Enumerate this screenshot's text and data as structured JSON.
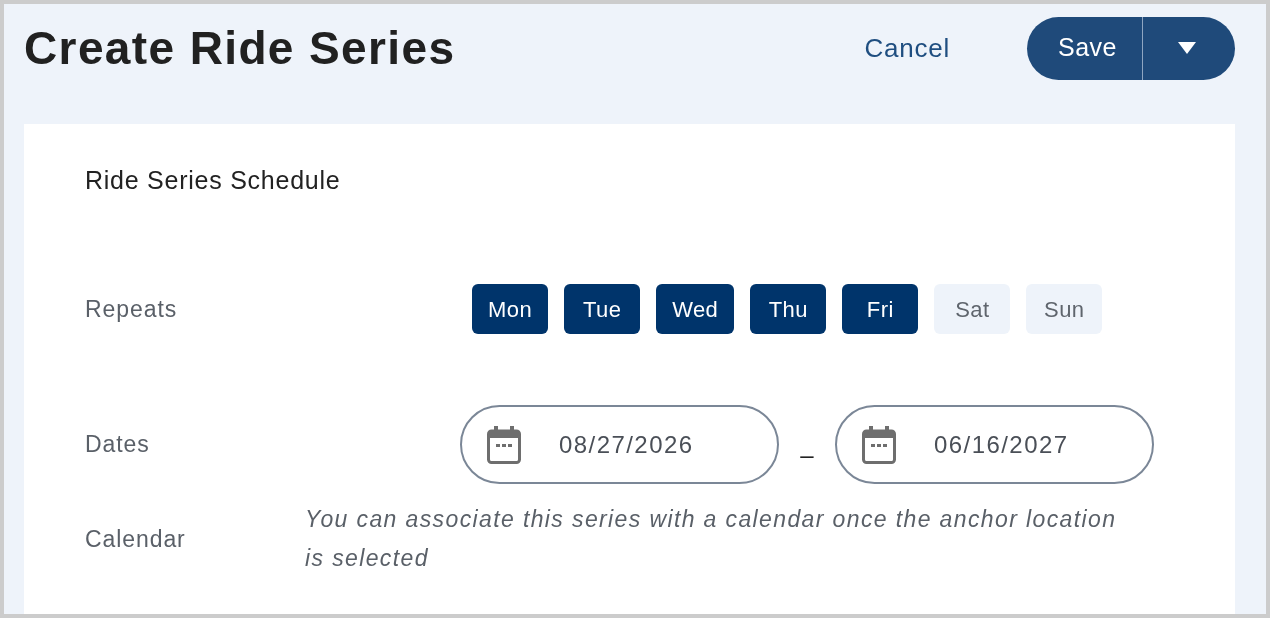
{
  "header": {
    "title": "Create Ride Series",
    "cancel": "Cancel",
    "save": "Save"
  },
  "schedule": {
    "title": "Ride Series Schedule",
    "rows": [
      {
        "kind": "days",
        "label": "Repeats",
        "days": [
          {
            "label": "Mon",
            "selected": true
          },
          {
            "label": "Tue",
            "selected": true
          },
          {
            "label": "Wed",
            "selected": true
          },
          {
            "label": "Thu",
            "selected": true
          },
          {
            "label": "Fri",
            "selected": true
          },
          {
            "label": "Sat",
            "selected": false
          },
          {
            "label": "Sun",
            "selected": false
          }
        ]
      },
      {
        "kind": "dates",
        "label": "Dates",
        "start": "08/27/2026",
        "separator": "–",
        "end": "06/16/2027"
      },
      {
        "kind": "note",
        "label": "Calendar",
        "note": "You can associate this series with a calendar once the anchor location is selected"
      }
    ]
  }
}
